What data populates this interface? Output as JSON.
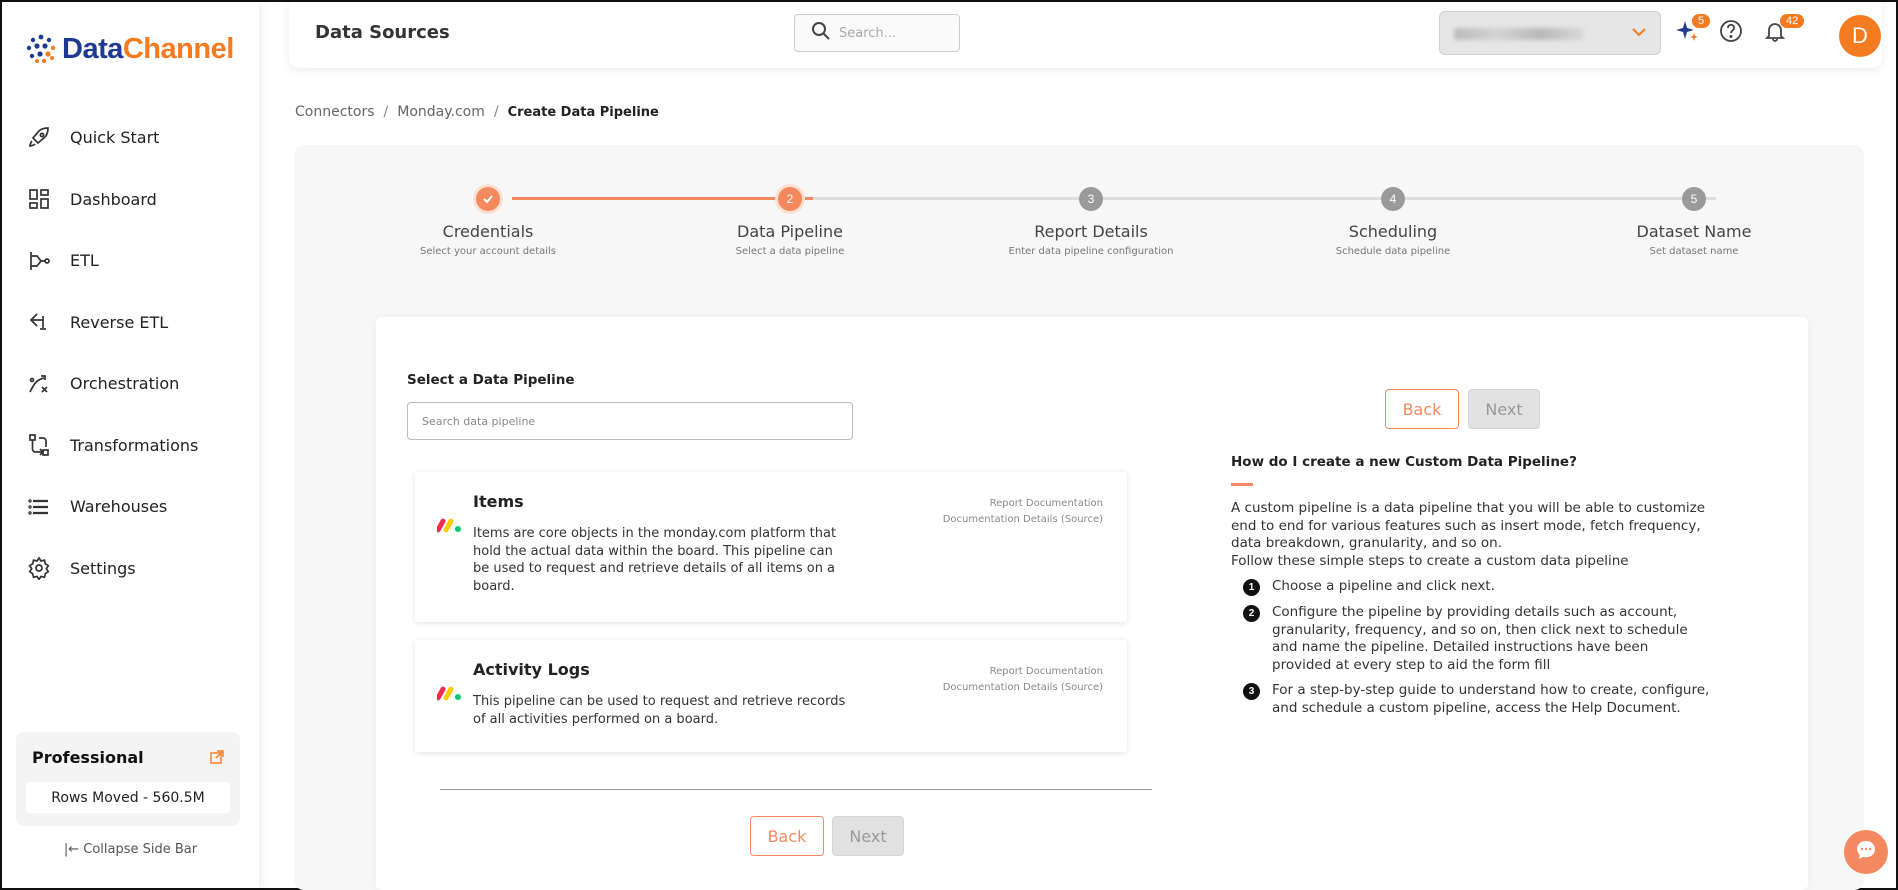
{
  "brand": {
    "word_part1": "Data",
    "word_part2": "Channel",
    "accent": "#f47b20",
    "primary": "#1f3a93"
  },
  "sidebar": {
    "items": [
      {
        "label": "Quick Start",
        "icon": "rocket-icon"
      },
      {
        "label": "Dashboard",
        "icon": "dashboard-icon"
      },
      {
        "label": "ETL",
        "icon": "etl-icon"
      },
      {
        "label": "Reverse ETL",
        "icon": "reverse-etl-icon"
      },
      {
        "label": "Orchestration",
        "icon": "orchestration-icon"
      },
      {
        "label": "Transformations",
        "icon": "transformations-icon"
      },
      {
        "label": "Warehouses",
        "icon": "warehouse-icon"
      },
      {
        "label": "Settings",
        "icon": "gear-icon"
      }
    ],
    "plan": {
      "title": "Professional",
      "rows": "Rows Moved - 560.5M"
    },
    "collapse": "Collapse Side Bar"
  },
  "header": {
    "title": "Data Sources",
    "search_placeholder": "Search...",
    "ai_badge": "5",
    "notif_badge": "42",
    "avatar": "D"
  },
  "breadcrumb": {
    "items": [
      "Connectors",
      "Monday.com"
    ],
    "current": "Create Data Pipeline",
    "sep": "/"
  },
  "stepper": {
    "steps": [
      {
        "num": "",
        "name": "Credentials",
        "sub": "Select your account details",
        "state": "done"
      },
      {
        "num": "2",
        "name": "Data Pipeline",
        "sub": "Select a data pipeline",
        "state": "active"
      },
      {
        "num": "3",
        "name": "Report Details",
        "sub": "Enter data pipeline configuration",
        "state": "pending"
      },
      {
        "num": "4",
        "name": "Scheduling",
        "sub": "Schedule data pipeline",
        "state": "pending"
      },
      {
        "num": "5",
        "name": "Dataset Name",
        "sub": "Set dataset name",
        "state": "pending"
      }
    ]
  },
  "content": {
    "select_label": "Select a Data Pipeline",
    "search_placeholder": "Search data pipeline",
    "back": "Back",
    "next": "Next",
    "pipelines": [
      {
        "title": "Items",
        "desc": "Items are core objects in the monday.com platform that hold the actual data within the board. This pipeline can be used to request and retrieve details of all items on a board.",
        "doc1": "Report Documentation",
        "doc2": "Documentation Details (Source)"
      },
      {
        "title": "Activity Logs",
        "desc": "This pipeline can be used to request and retrieve records of all activities performed on a board.",
        "doc1": "Report Documentation",
        "doc2": "Documentation Details (Source)"
      }
    ]
  },
  "help": {
    "heading": "How do I create a new Custom Data Pipeline?",
    "para": "A custom pipeline is a data pipeline that you will be able to customize end to end for various features such as insert mode, fetch frequency, data breakdown, granularity, and so on.",
    "para2": "Follow these simple steps to create a custom data pipeline",
    "steps": [
      {
        "n": "1",
        "text": "Choose a pipeline and click next."
      },
      {
        "n": "2",
        "text": "Configure the pipeline by providing details such as account, granularity, frequency, and so on, then click next to schedule and name the pipeline. Detailed instructions have been provided at every step to aid the form fill"
      },
      {
        "n": "3",
        "text": "For a step-by-step guide to understand how to create, configure, and schedule a custom pipeline, access the Help Document."
      }
    ]
  }
}
